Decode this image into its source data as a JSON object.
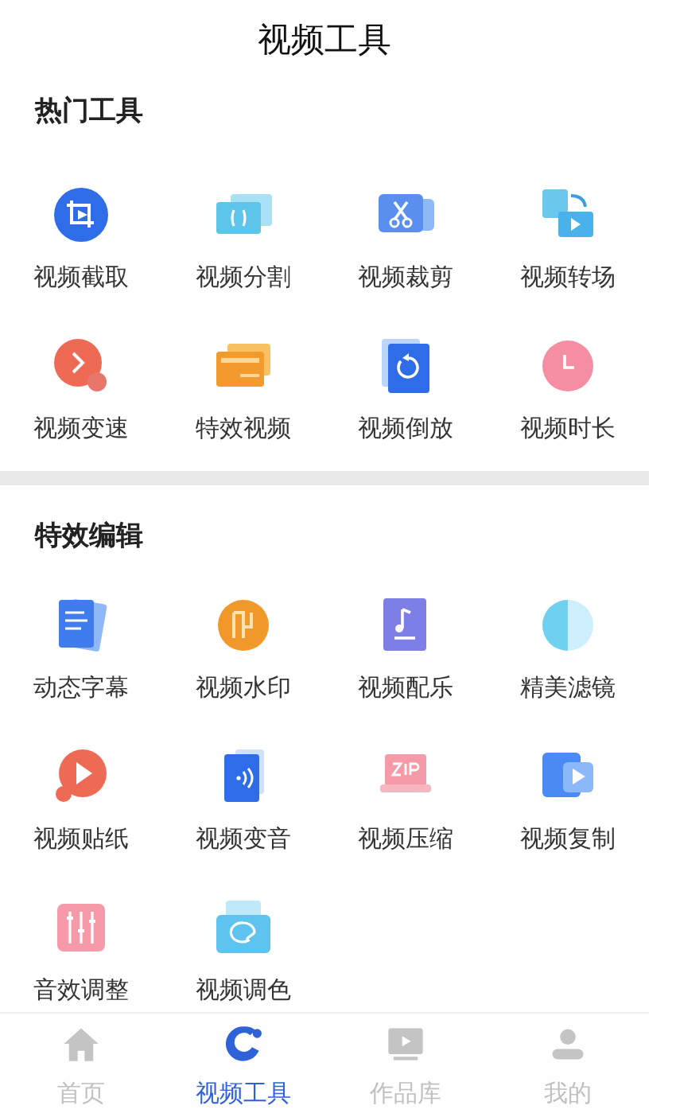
{
  "title": "视频工具",
  "sections": [
    {
      "title": "热门工具",
      "tools": [
        {
          "label": "视频截取"
        },
        {
          "label": "视频分割"
        },
        {
          "label": "视频裁剪"
        },
        {
          "label": "视频转场"
        },
        {
          "label": "视频变速"
        },
        {
          "label": "特效视频"
        },
        {
          "label": "视频倒放"
        },
        {
          "label": "视频时长"
        }
      ]
    },
    {
      "title": "特效编辑",
      "tools": [
        {
          "label": "动态字幕"
        },
        {
          "label": "视频水印"
        },
        {
          "label": "视频配乐"
        },
        {
          "label": "精美滤镜"
        },
        {
          "label": "视频贴纸"
        },
        {
          "label": "视频变音"
        },
        {
          "label": "视频压缩"
        },
        {
          "label": "视频复制"
        },
        {
          "label": "音效调整"
        },
        {
          "label": "视频调色"
        }
      ]
    }
  ],
  "tab_bar": [
    {
      "label": "首页",
      "selected": false
    },
    {
      "label": "视频工具",
      "selected": true
    },
    {
      "label": "作品库",
      "selected": false
    },
    {
      "label": "我的",
      "selected": false
    }
  ]
}
